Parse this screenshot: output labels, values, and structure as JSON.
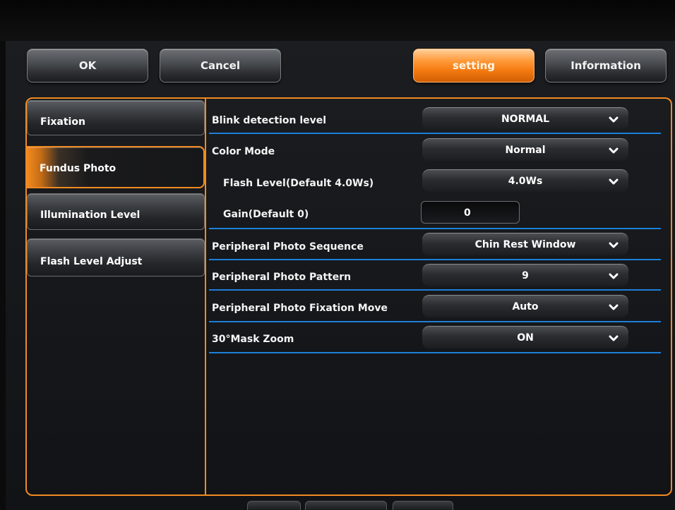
{
  "toolbar": {
    "ok_label": "OK",
    "cancel_label": "Cancel",
    "setting_label": "setting",
    "information_label": "Information"
  },
  "sidebar": {
    "items": [
      {
        "label": "Fixation"
      },
      {
        "label": "Fundus Photo",
        "active": true
      },
      {
        "label": "Illumination Level"
      },
      {
        "label": "Flash Level Adjust"
      }
    ]
  },
  "settings": {
    "blink_detection": {
      "label": "Blink detection level",
      "value": "NORMAL"
    },
    "color_mode": {
      "label": "Color Mode",
      "value": "Normal"
    },
    "flash_level": {
      "label": "Flash Level(Default 4.0Ws)",
      "value": "4.0Ws"
    },
    "gain": {
      "label": "Gain(Default 0)",
      "value": "0"
    },
    "peripheral_sequence": {
      "label": "Peripheral Photo Sequence",
      "value": "Chin Rest Window"
    },
    "peripheral_pattern": {
      "label": "Peripheral Photo Pattern",
      "value": "9"
    },
    "peripheral_fixation_move": {
      "label": "Peripheral Photo Fixation Move",
      "value": "Auto"
    },
    "mask_zoom": {
      "label": "30°Mask Zoom",
      "value": "ON"
    }
  },
  "colors": {
    "accent": "#f18a22",
    "separator": "#1c7fd8",
    "background": "#16181b"
  }
}
